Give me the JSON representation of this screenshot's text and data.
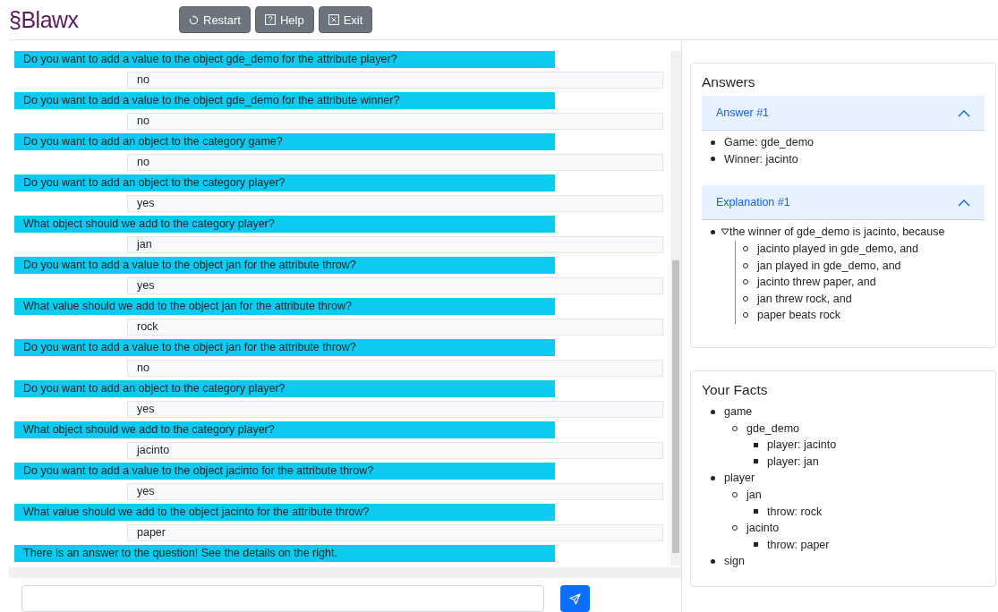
{
  "header": {
    "logo": "§Blawx",
    "buttons": [
      {
        "kind": "restart",
        "label": "Restart"
      },
      {
        "kind": "help",
        "label": "Help"
      },
      {
        "kind": "exit",
        "label": "Exit"
      }
    ]
  },
  "chat": {
    "messages": [
      {
        "kind": "question",
        "text": "Do you want to add a value to the object gde_demo for the attribute player?"
      },
      {
        "kind": "answer",
        "text": "no"
      },
      {
        "kind": "question",
        "text": "Do you want to add a value to the object gde_demo for the attribute winner?"
      },
      {
        "kind": "answer",
        "text": "no"
      },
      {
        "kind": "question",
        "text": "Do you want to add an object to the category game?"
      },
      {
        "kind": "answer",
        "text": "no"
      },
      {
        "kind": "question",
        "text": "Do you want to add an object to the category player?"
      },
      {
        "kind": "answer",
        "text": "yes"
      },
      {
        "kind": "question",
        "text": "What object should we add to the category player?"
      },
      {
        "kind": "answer",
        "text": "jan"
      },
      {
        "kind": "question",
        "text": "Do you want to add a value to the object jan for the attribute throw?"
      },
      {
        "kind": "answer",
        "text": "yes"
      },
      {
        "kind": "question",
        "text": "What value should we add to the object jan for the attribute throw?"
      },
      {
        "kind": "answer",
        "text": "rock"
      },
      {
        "kind": "question",
        "text": "Do you want to add a value to the object jan for the attribute throw?"
      },
      {
        "kind": "answer",
        "text": "no"
      },
      {
        "kind": "question",
        "text": "Do you want to add an object to the category player?"
      },
      {
        "kind": "answer",
        "text": "yes"
      },
      {
        "kind": "question",
        "text": "What object should we add to the category player?"
      },
      {
        "kind": "answer",
        "text": "jacinto"
      },
      {
        "kind": "question",
        "text": "Do you want to add a value to the object jacinto for the attribute throw?"
      },
      {
        "kind": "answer",
        "text": "yes"
      },
      {
        "kind": "question",
        "text": "What value should we add to the object jacinto for the attribute throw?"
      },
      {
        "kind": "answer",
        "text": "paper"
      },
      {
        "kind": "question",
        "text": "There is an answer to the question! See the details on the right."
      }
    ]
  },
  "answers": {
    "title": "Answers",
    "sections": [
      {
        "title": "Answer #1",
        "expanded": true,
        "items": [
          {
            "text": "Game: gde_demo"
          },
          {
            "text": "Winner: jacinto"
          }
        ]
      },
      {
        "title": "Explanation #1",
        "expanded": true,
        "items": [
          {
            "text": "the winner of gde_demo is jacinto, because",
            "expanded": true,
            "children": [
              {
                "text": "jacinto played in gde_demo, and"
              },
              {
                "text": "jan played in gde_demo, and"
              },
              {
                "text": "jacinto threw paper, and"
              },
              {
                "text": "jan threw rock, and"
              },
              {
                "text": "paper beats rock"
              }
            ]
          }
        ]
      }
    ]
  },
  "facts": {
    "title": "Your Facts",
    "items": [
      {
        "text": "game",
        "children": [
          {
            "text": "gde_demo",
            "children": [
              {
                "text": "player: jacinto"
              },
              {
                "text": "player: jan"
              }
            ]
          }
        ]
      },
      {
        "text": "player",
        "children": [
          {
            "text": "jan",
            "children": [
              {
                "text": "throw: rock"
              }
            ]
          },
          {
            "text": "jacinto",
            "children": [
              {
                "text": "throw: paper"
              }
            ]
          }
        ]
      },
      {
        "text": "sign"
      }
    ]
  }
}
